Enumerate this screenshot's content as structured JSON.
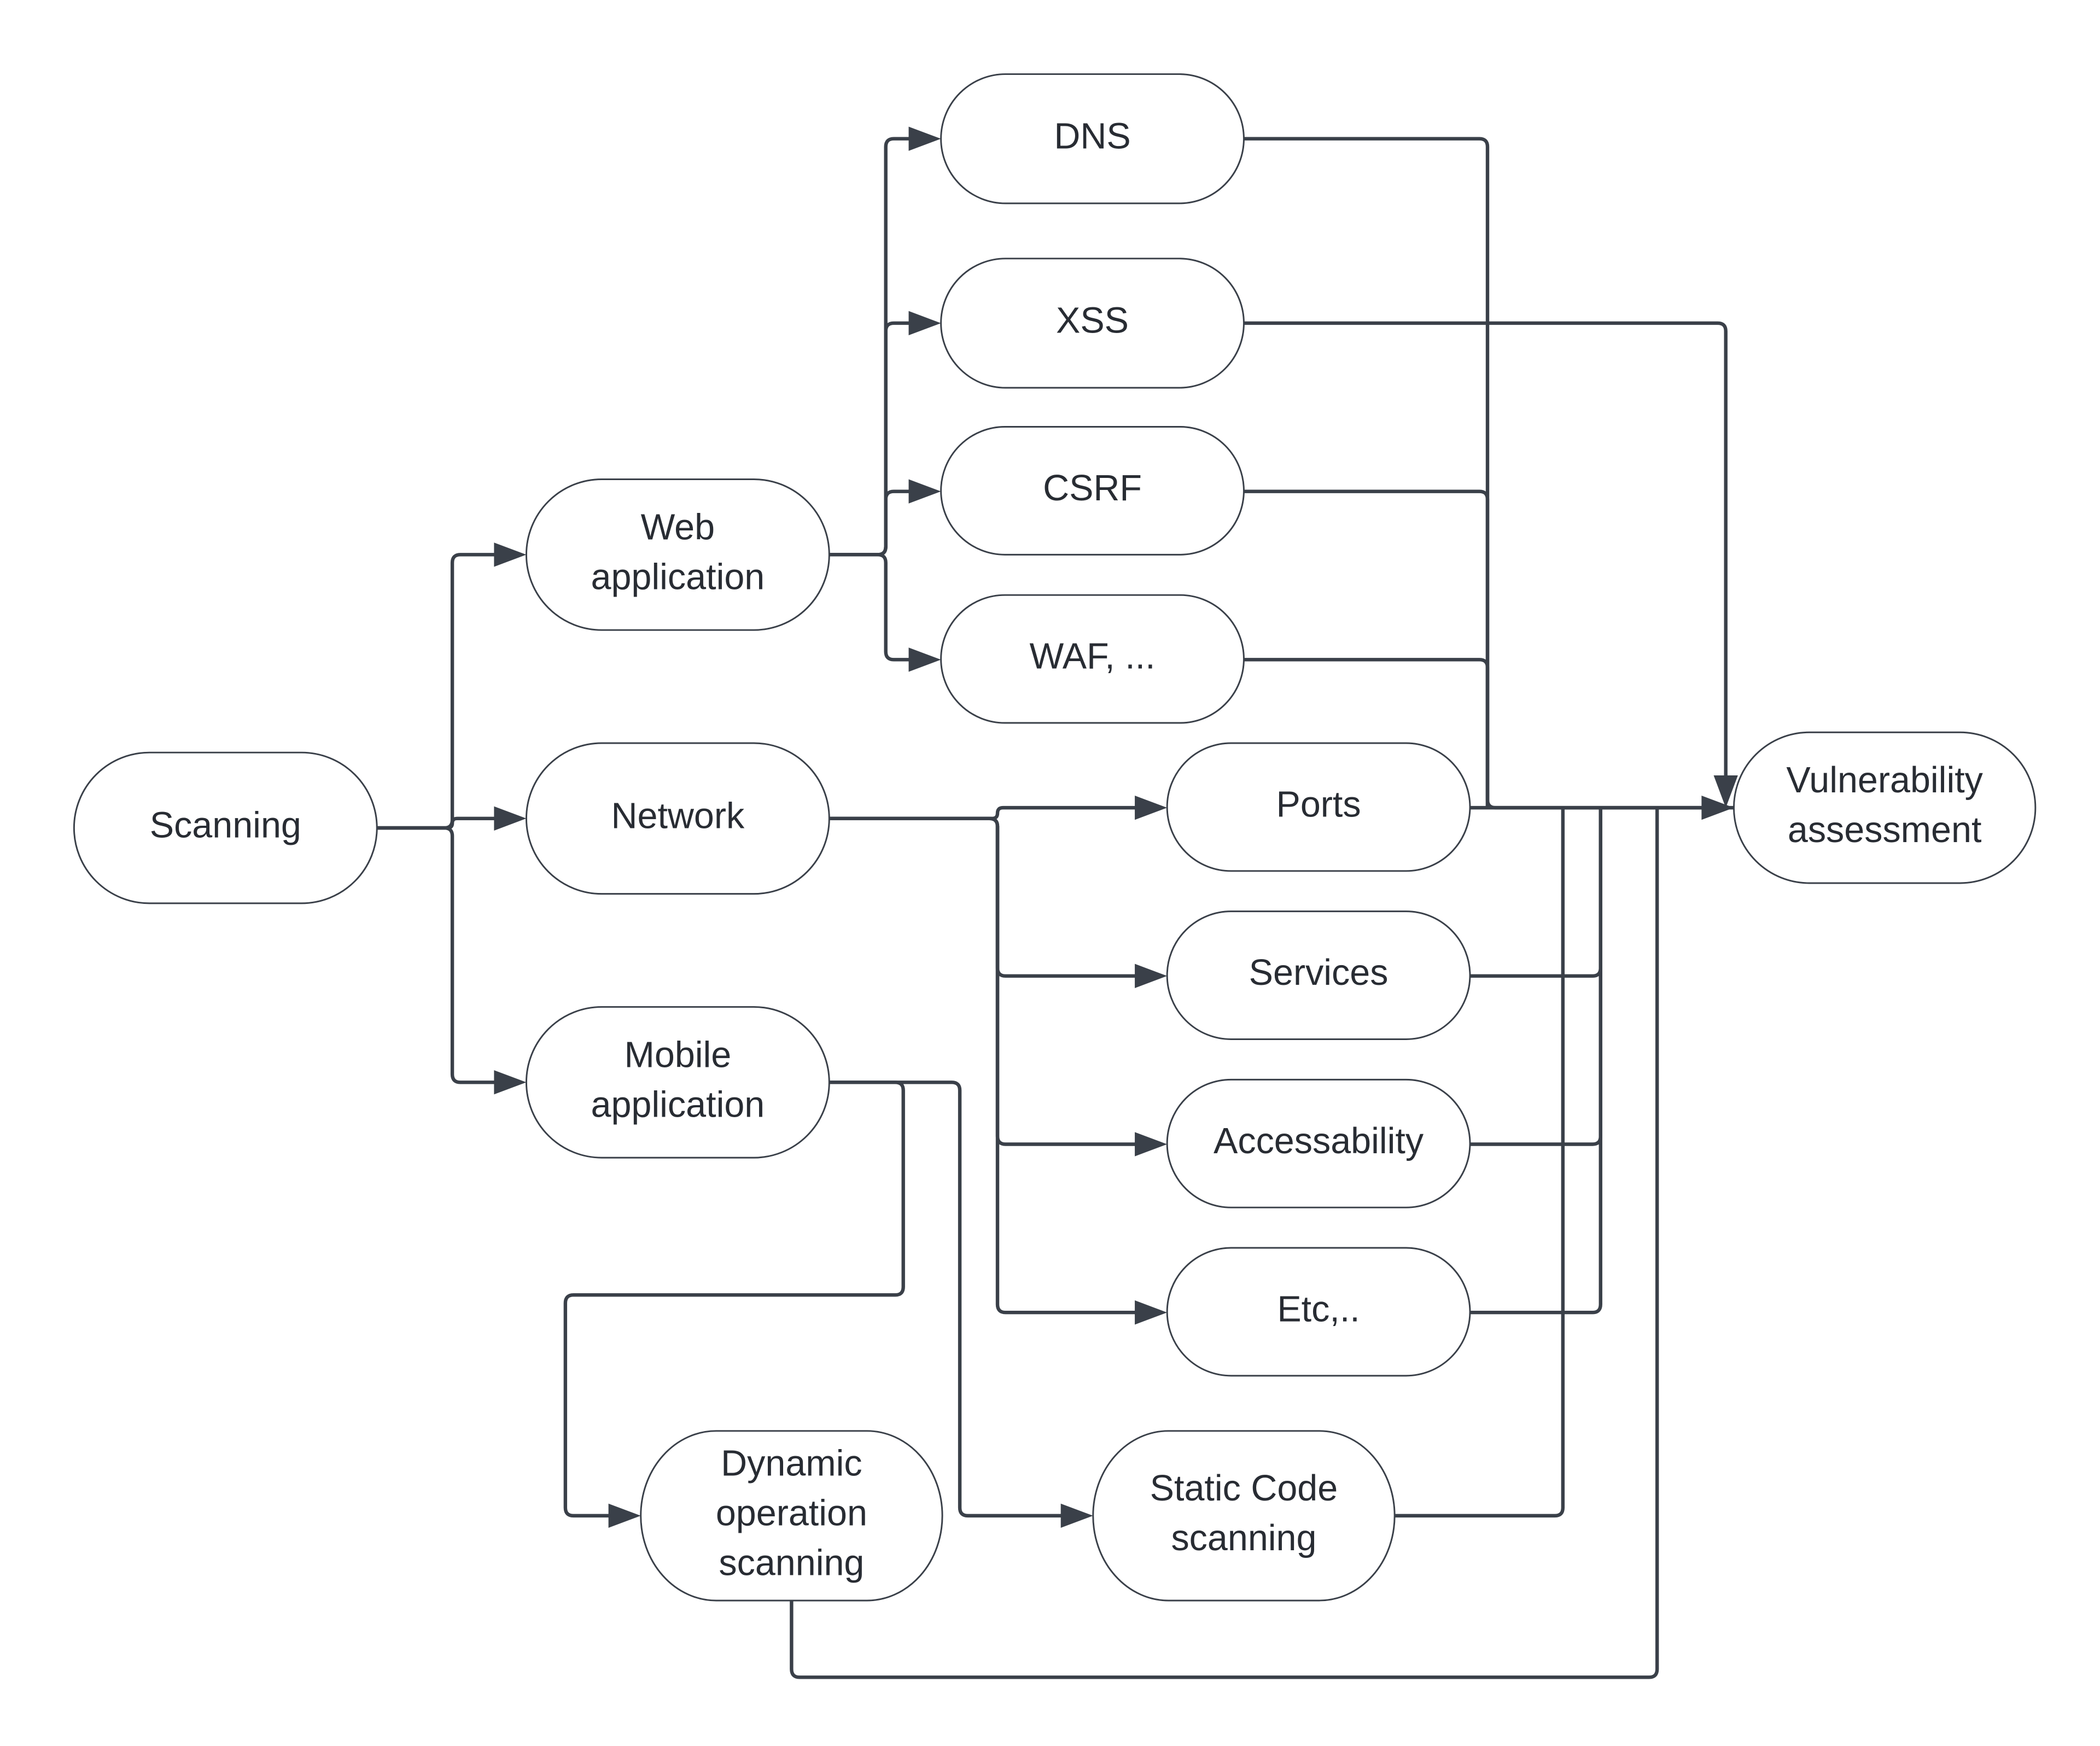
{
  "diagram": {
    "type": "flowchart",
    "colors": {
      "line": "#3a4049",
      "text": "#282c33",
      "node_fill": "#ffffff"
    },
    "nodes": [
      {
        "id": "scanning",
        "lines": [
          "Scanning"
        ]
      },
      {
        "id": "web",
        "lines": [
          "Web",
          "application"
        ]
      },
      {
        "id": "network",
        "lines": [
          "Network"
        ]
      },
      {
        "id": "mobile",
        "lines": [
          "Mobile",
          "application"
        ]
      },
      {
        "id": "dns",
        "lines": [
          "DNS"
        ]
      },
      {
        "id": "xss",
        "lines": [
          "XSS"
        ]
      },
      {
        "id": "csrf",
        "lines": [
          "CSRF"
        ]
      },
      {
        "id": "waf",
        "lines": [
          "WAF, ..."
        ]
      },
      {
        "id": "ports",
        "lines": [
          "Ports"
        ]
      },
      {
        "id": "services",
        "lines": [
          "Services"
        ]
      },
      {
        "id": "accessability",
        "lines": [
          "Accessability"
        ]
      },
      {
        "id": "etc",
        "lines": [
          "Etc,.."
        ]
      },
      {
        "id": "dynamic",
        "lines": [
          "Dynamic",
          "operation",
          "scanning"
        ]
      },
      {
        "id": "static",
        "lines": [
          "Static Code",
          "scanning"
        ]
      },
      {
        "id": "vuln",
        "lines": [
          "Vulnerability",
          "assessment"
        ]
      }
    ],
    "edges": [
      {
        "from": "scanning",
        "to": "web"
      },
      {
        "from": "scanning",
        "to": "network"
      },
      {
        "from": "scanning",
        "to": "mobile"
      },
      {
        "from": "web",
        "to": "dns"
      },
      {
        "from": "web",
        "to": "xss"
      },
      {
        "from": "web",
        "to": "csrf"
      },
      {
        "from": "web",
        "to": "waf"
      },
      {
        "from": "network",
        "to": "ports"
      },
      {
        "from": "network",
        "to": "services"
      },
      {
        "from": "network",
        "to": "accessability"
      },
      {
        "from": "network",
        "to": "etc"
      },
      {
        "from": "mobile",
        "to": "dynamic"
      },
      {
        "from": "mobile",
        "to": "static"
      },
      {
        "from": "dns",
        "to": "vuln"
      },
      {
        "from": "xss",
        "to": "vuln"
      },
      {
        "from": "csrf",
        "to": "vuln"
      },
      {
        "from": "waf",
        "to": "vuln"
      },
      {
        "from": "ports",
        "to": "vuln"
      },
      {
        "from": "services",
        "to": "vuln"
      },
      {
        "from": "accessability",
        "to": "vuln"
      },
      {
        "from": "etc",
        "to": "vuln"
      },
      {
        "from": "static",
        "to": "vuln"
      },
      {
        "from": "dynamic",
        "to": "vuln"
      }
    ]
  }
}
